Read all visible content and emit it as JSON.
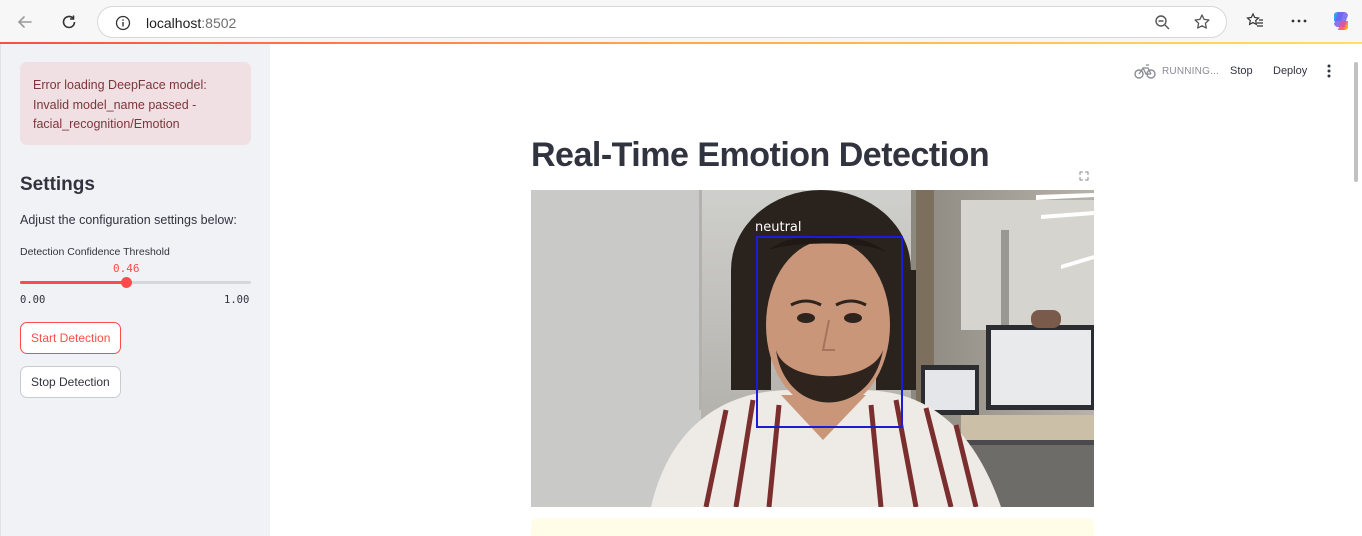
{
  "browser": {
    "url_host": "localhost",
    "url_port": ":8502"
  },
  "sidebar": {
    "error_message": "Error loading DeepFace model: Invalid model_name passed - facial_recognition/Emotion",
    "settings_title": "Settings",
    "settings_description": "Adjust the configuration settings below:",
    "slider": {
      "label": "Detection Confidence Threshold",
      "value": 0.46,
      "value_text": "0.46",
      "min_text": "0.00",
      "max_text": "1.00",
      "accent_color": "#ff4b4b"
    },
    "start_button": "Start Detection",
    "stop_button": "Stop Detection"
  },
  "header": {
    "status": "RUNNING...",
    "stop": "Stop",
    "deploy": "Deploy"
  },
  "main": {
    "title": "Real-Time Emotion Detection",
    "detection_label": "neutral",
    "box_color": "#1c1bd6"
  }
}
